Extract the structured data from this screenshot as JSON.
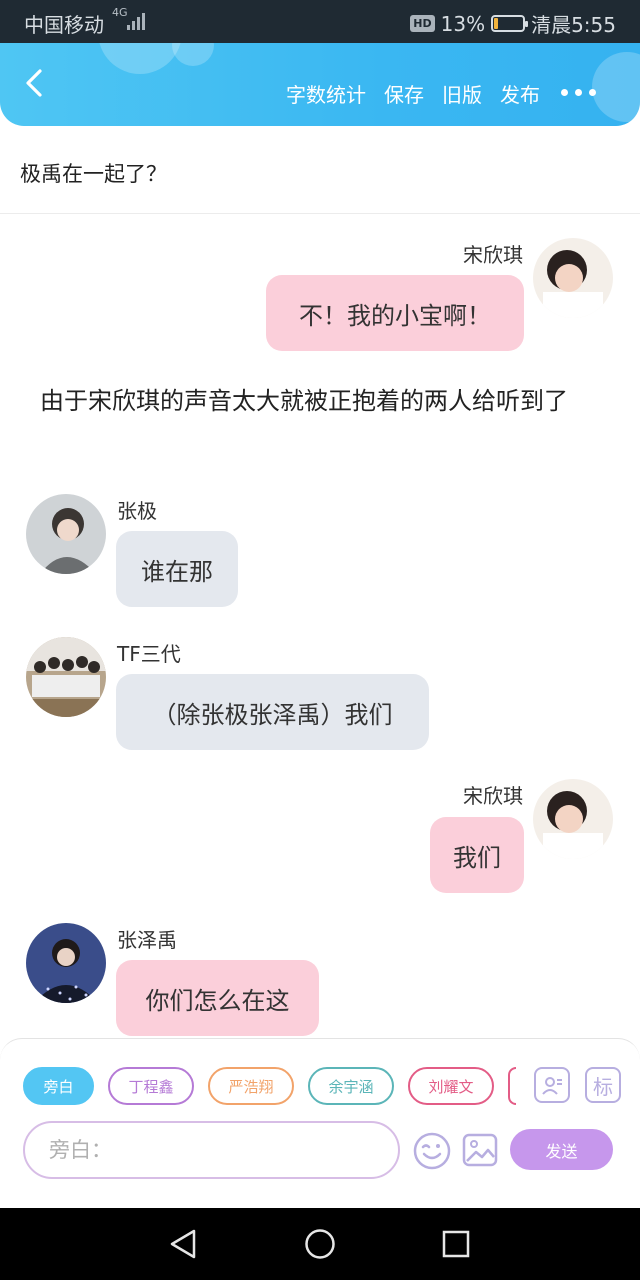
{
  "status": {
    "carrier": "中国移动",
    "network": "4G",
    "hd": "HD",
    "battery_pct": "13%",
    "battery_level": 0.13,
    "time": "清晨5:55"
  },
  "nav": {
    "actions": [
      "字数统计",
      "保存",
      "旧版",
      "发布"
    ]
  },
  "title": "极禹在一起了？",
  "messages": [
    {
      "side": "right",
      "name": "宋欣琪",
      "text": "不！我的小宝啊！",
      "color": "#fbcfda"
    },
    {
      "side": "narration",
      "text": "由于宋欣琪的声音太大就被正抱着的两人给听到了"
    },
    {
      "side": "left",
      "name": "张极",
      "text": "谁在那",
      "color": "#e4e8ee"
    },
    {
      "side": "left",
      "name": "TF三代",
      "text": "（除张极张泽禹）我们",
      "color": "#e4e8ee"
    },
    {
      "side": "right",
      "name": "宋欣琪",
      "text": "我们",
      "color": "#fbcfda"
    },
    {
      "side": "left",
      "name": "张泽禹",
      "text": "你们怎么在这",
      "color": "#fbcfda"
    }
  ],
  "composer": {
    "roles": [
      {
        "label": "旁白",
        "active": true,
        "color": "#53c6f3"
      },
      {
        "label": "丁程鑫",
        "active": false,
        "color": "#b57ad6"
      },
      {
        "label": "严浩翔",
        "active": false,
        "color": "#f2a36a"
      },
      {
        "label": "余宇涵",
        "active": false,
        "color": "#5bb5b8"
      },
      {
        "label": "刘耀文",
        "active": false,
        "color": "#e35c86"
      }
    ],
    "tag_label": "标",
    "input_placeholder": "旁白：",
    "send_label": "发送"
  }
}
